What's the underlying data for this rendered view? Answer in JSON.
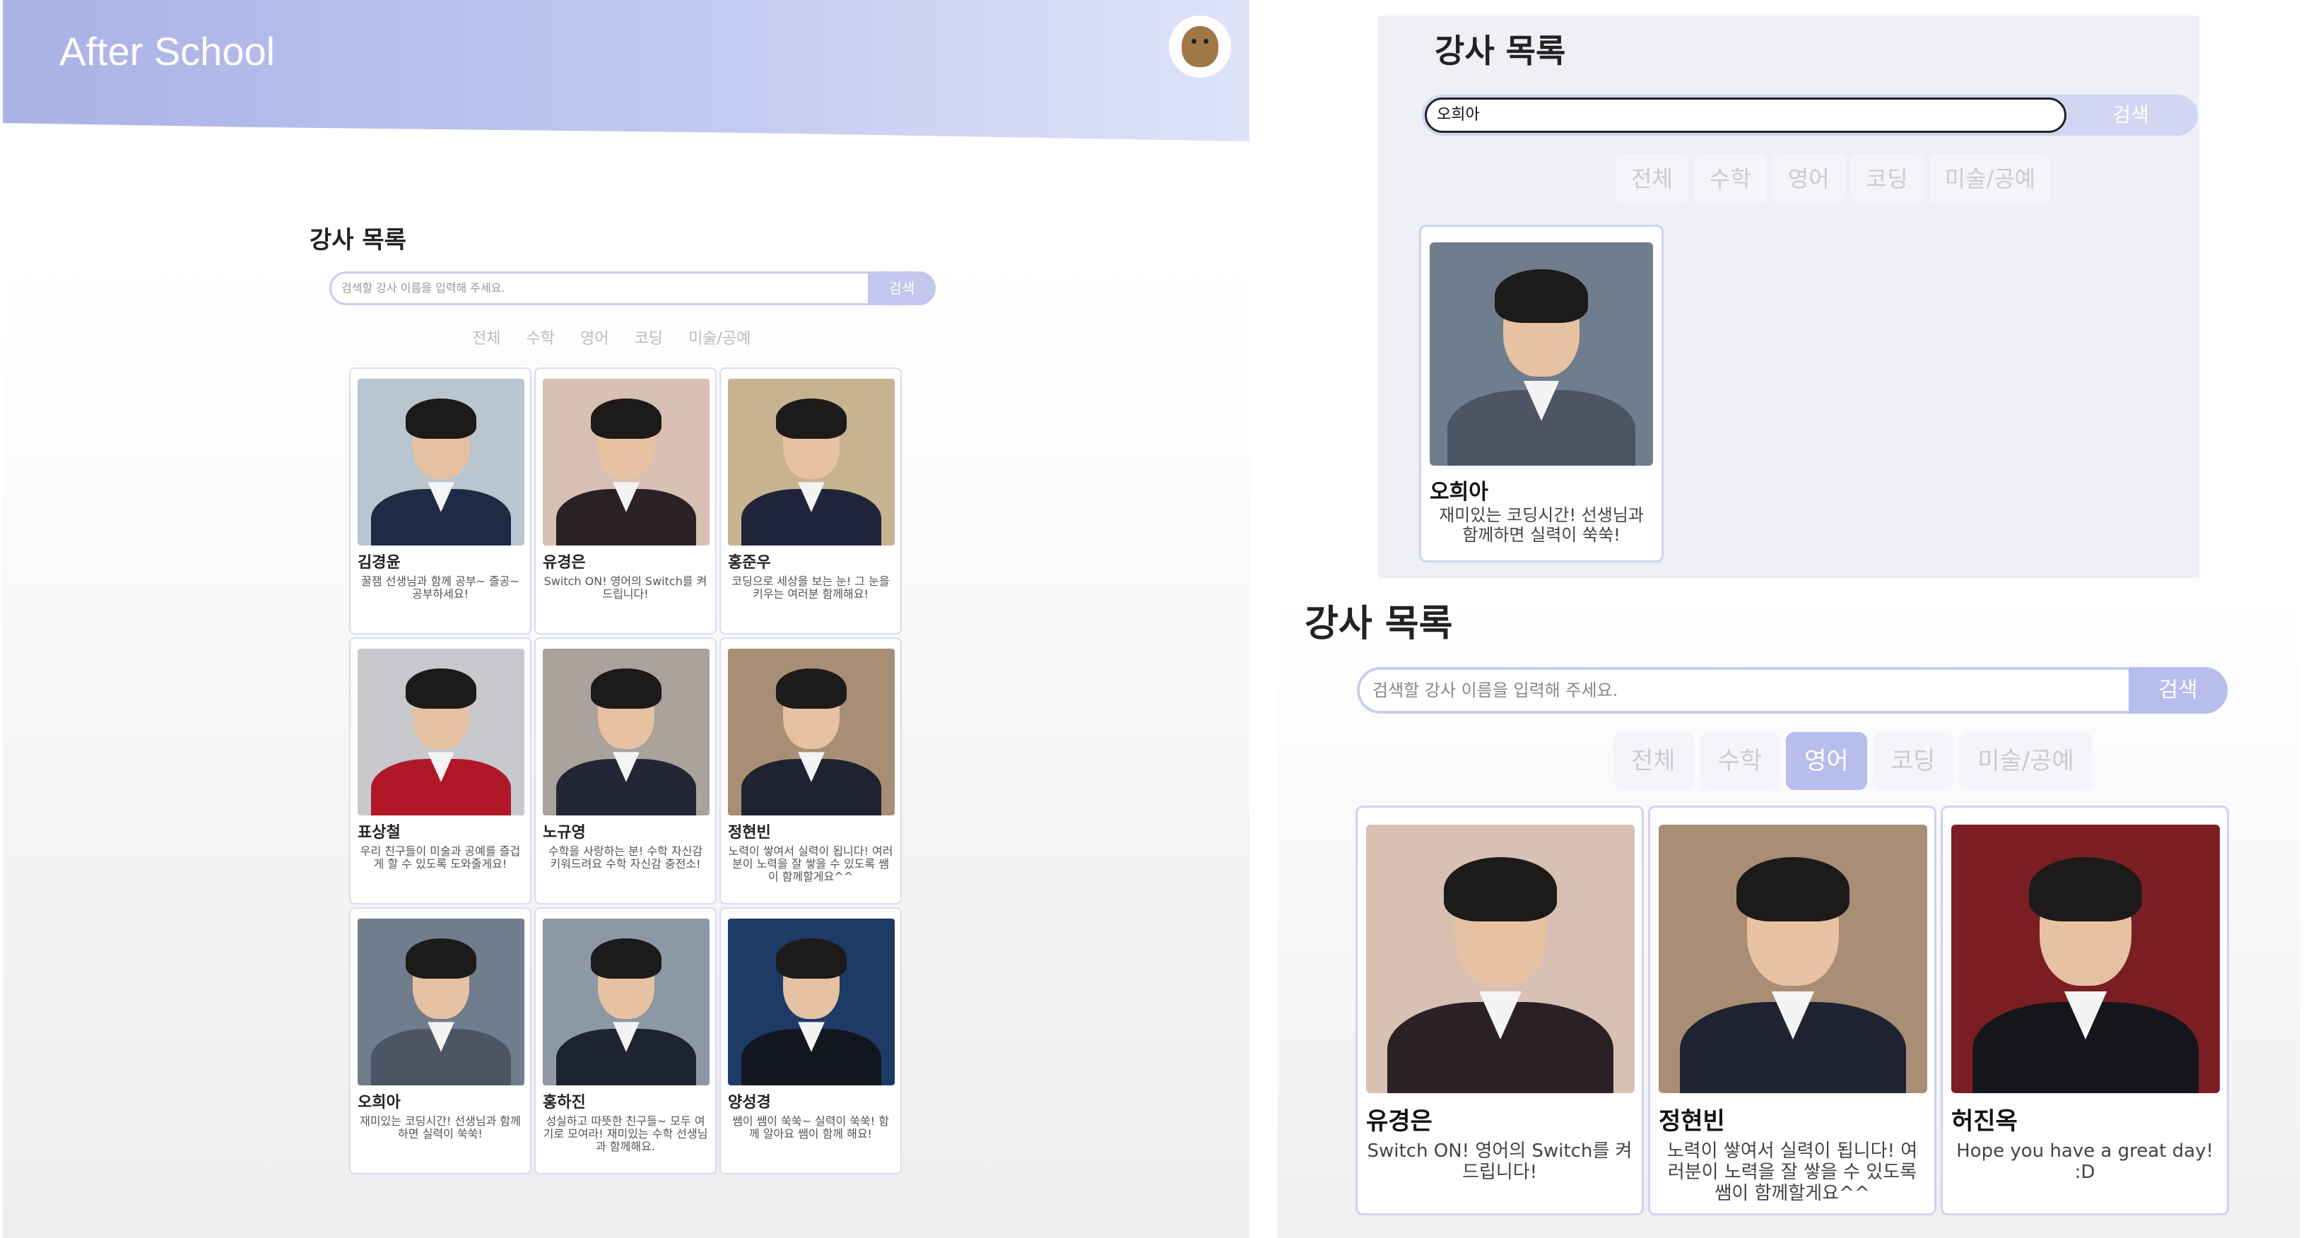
{
  "app": {
    "brand": "After School"
  },
  "left": {
    "title": "강사 목록",
    "search": {
      "placeholder": "검색할 강사 이름을 입력해 주세요.",
      "button": "검색"
    },
    "filters": [
      "전체",
      "수학",
      "영어",
      "코딩",
      "미술/공예"
    ],
    "cards": [
      {
        "name": "김경윤",
        "desc": "꿀잼 선생님과 함께 공부~ 즐공~ 공부하세요!",
        "bg": "#b9c6cf",
        "suit": "#1f2a44"
      },
      {
        "name": "유경은",
        "desc": "Switch ON! 영어의 Switch를 켜 드립니다!",
        "bg": "#d8c0b3",
        "suit": "#2a2126"
      },
      {
        "name": "홍준우",
        "desc": "코딩으로 세상을 보는 눈! 그 눈을 키우는 여러분 함께해요!",
        "bg": "#c8b390",
        "suit": "#20243a"
      },
      {
        "name": "표상철",
        "desc": "우리 친구들이 미술과 공예를 즐겁게 할 수 있도록 도와줄게요!",
        "bg": "#c7c9cd",
        "suit": "#b0182a"
      },
      {
        "name": "노규영",
        "desc": "수학을 사랑하는 분! 수학 자신감 키워드려요 수학 자신감 충전소!",
        "bg": "#a9a39c",
        "suit": "#232634"
      },
      {
        "name": "정현빈",
        "desc": "노력이 쌓여서 실력이 됩니다! 여러분이 노력을 잘 쌓을 수 있도록 쌤이 함께할게요^^",
        "bg": "#a88e74",
        "suit": "#1f2230"
      },
      {
        "name": "오희아",
        "desc": "재미있는 코딩시간! 선생님과 함께하면 실력이 쑥쑥!",
        "bg": "#6f7d8c",
        "suit": "#4b5564"
      },
      {
        "name": "홍하진",
        "desc": "성실하고 따뜻한 친구들~ 모두 여기로 모여라! 재미있는 수학 선생님과 함께해요.",
        "bg": "#8d98a6",
        "suit": "#1d2330"
      },
      {
        "name": "양성경",
        "desc": "쌤이 쌤이 쑥쑥~ 실력이 쑥쑥! 함께 알아요 쌤이 함께 해요!",
        "bg": "#1e3a66",
        "suit": "#14161f"
      }
    ]
  },
  "right_top": {
    "title": "강사 목록",
    "search": {
      "value": "오희아",
      "button": "검색"
    },
    "filters": [
      "전체",
      "수학",
      "영어",
      "코딩",
      "미술/공예"
    ],
    "card": {
      "name": "오희아",
      "desc": "재미있는 코딩시간! 선생님과 함께하면 실력이 쑥쑥!",
      "bg": "#6f7d8c",
      "suit": "#4b5564"
    }
  },
  "right_bottom": {
    "title": "강사 목록",
    "search": {
      "placeholder": "검색할 강사 이름을 입력해 주세요.",
      "button": "검색"
    },
    "filters": [
      "전체",
      "수학",
      "영어",
      "코딩",
      "미술/공예"
    ],
    "active_filter": "영어",
    "cards": [
      {
        "name": "유경은",
        "desc": "Switch ON! 영어의 Switch를 켜 드립니다!",
        "bg": "#d8c0b3",
        "suit": "#2a2126"
      },
      {
        "name": "정현빈",
        "desc": "노력이 쌓여서 실력이 됩니다! 여러분이 노력을 잘 쌓을 수 있도록 쌤이 함께할게요^^",
        "bg": "#a88e74",
        "suit": "#1f2230"
      },
      {
        "name": "허진옥",
        "desc": "Hope you have a great day! :D",
        "bg": "#7b1e24",
        "suit": "#15161b"
      }
    ]
  }
}
